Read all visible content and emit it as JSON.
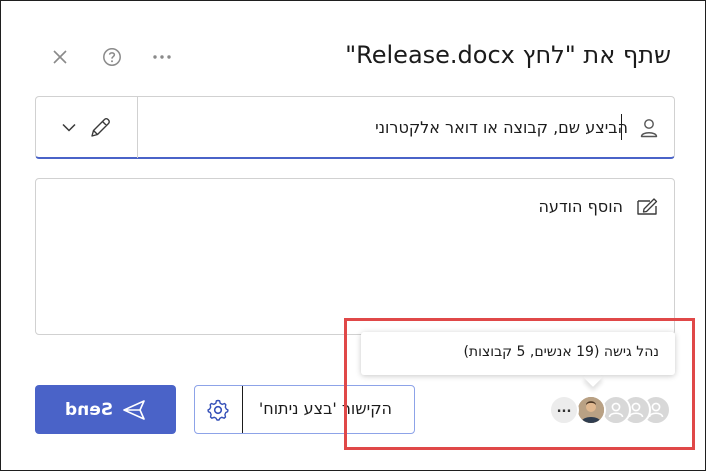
{
  "dialog": {
    "title": "שתף את \"לחץ Release.docx\""
  },
  "header_icons": [
    "close-icon",
    "help-icon",
    "more-options-icon"
  ],
  "to_field": {
    "placeholder": "הביצע שם, קבוצה או דואר אלקטרוני",
    "value": "",
    "permission_icon": "pencil-icon",
    "dropdown_icon": "chevron-down-icon",
    "leading_icon": "person-icon"
  },
  "message": {
    "placeholder": "הוסף הודעה",
    "icon": "message-edit-icon"
  },
  "send_button": {
    "label": "Send",
    "icon": "send-icon",
    "color": "#4a63c8"
  },
  "link_settings": {
    "label": "הקישור 'בצע ניתוח'",
    "icon": "gear-icon"
  },
  "access": {
    "tooltip": "נהל גישה (19 אנשים, 5 קבוצות)",
    "more_label": "...",
    "highlight_color": "#e04848"
  }
}
